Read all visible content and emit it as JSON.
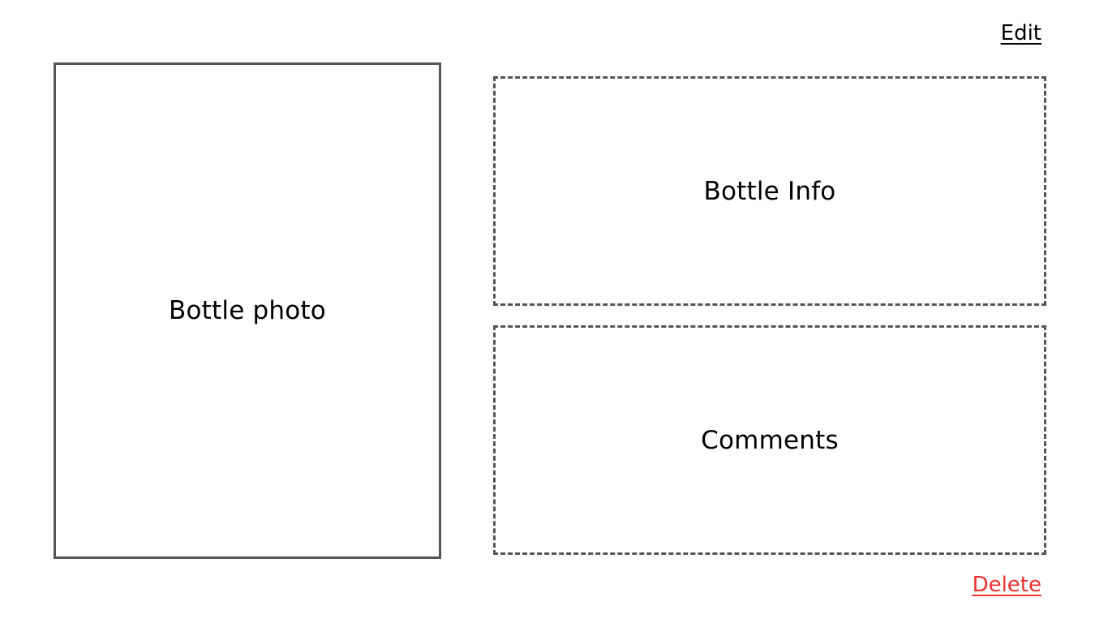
{
  "header": {
    "edit_label": "Edit"
  },
  "photo": {
    "label": "Bottle photo"
  },
  "info": {
    "label": "Bottle Info"
  },
  "comments": {
    "label": "Comments"
  },
  "footer": {
    "delete_label": "Delete"
  },
  "colors": {
    "delete": "#e8312f",
    "border": "#555555"
  }
}
